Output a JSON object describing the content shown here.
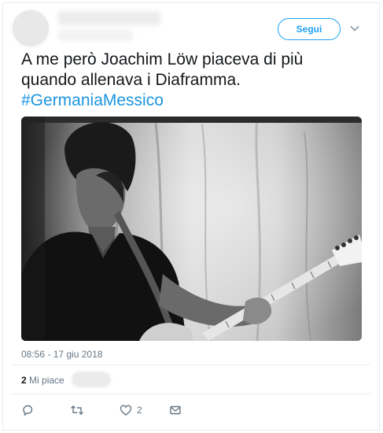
{
  "header": {
    "follow_label": "Segui"
  },
  "tweet": {
    "text_line1": "A me però Joachim Löw piaceva di più",
    "text_line2": "quando allenava i Diaframma.",
    "hashtag": "#GermaniaMessico",
    "timestamp": "08:56 - 17 giu 2018"
  },
  "stats": {
    "likes_count": "2",
    "likes_label": "Mi piace"
  },
  "actions": {
    "reply_icon": "reply-icon",
    "retweet_icon": "retweet-icon",
    "like_icon": "heart-icon",
    "like_count": "2",
    "dm_icon": "envelope-icon"
  },
  "colors": {
    "accent": "#1da1f2",
    "hashtag": "#1b95e0",
    "muted": "#657786",
    "text": "#14171a",
    "border": "#e6ecf0"
  }
}
